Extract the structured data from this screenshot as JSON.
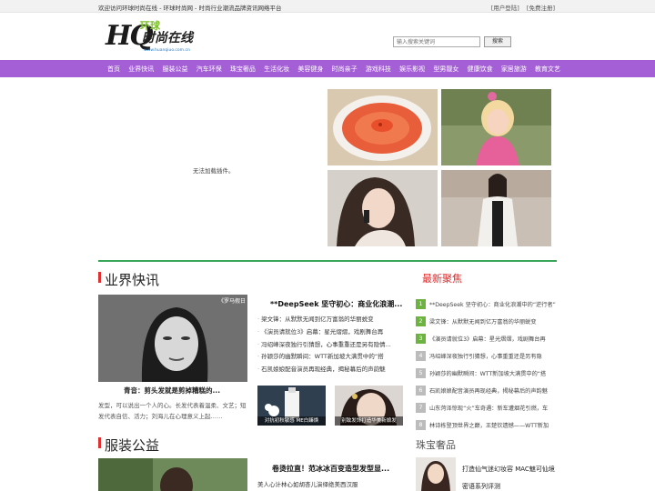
{
  "topbar": {
    "welcome": "欢迎访问环球时尚在线 - 环球时尚网 - 时尚行业潮流品牌资讯网络平台",
    "login": "[用户登陆]",
    "register": "[免费注册]"
  },
  "logo": {
    "hq": "HQ",
    "huanqiu": "环球",
    "fashion": "时尚在线",
    "url": "www.huanqiuo.com.cn"
  },
  "search": {
    "placeholder": "输入搜索关键词",
    "button": "搜索"
  },
  "nav": [
    "首页",
    "业界快讯",
    "服装公益",
    "汽车环保",
    "珠宝奢品",
    "生活化妆",
    "美容健身",
    "时尚亲子",
    "游戏科技",
    "娱乐影视",
    "型男靓女",
    "健康饮食",
    "家居旅游",
    "教育文艺"
  ],
  "plugin_message": "无法加载插件。",
  "section1": {
    "title": "业界快讯",
    "photo_caption": "青音：剪头发就是剪掉糟糕的...",
    "photo_overlay": "《罗马假日",
    "desc": "发型，可以说出一个人的心。长发代表着温柔、文艺；短发代表自信、活力；刘海儿在心理意义上起……",
    "headline": "**DeepSeek 坚守初心：商业化浪潮...",
    "news": [
      "梁文锋：从默默无闻到亿万富翁的华丽蜕变",
      "《演员请就位3》启幕：星光熠熠，戏剧舞台再",
      "冯绍峰深夜独行引猜想，心事重重还是另有隐情...",
      "孙颖莎的幽默瞬间：WTT新加坡大满贯中的“搭",
      "石凯娘娘配音演员再现经典，揭秘幕后的声韵魅"
    ],
    "small_pics": [
      "对抗初秋敏感 ME白臻焕",
      "别致发饰打造华美新娘发"
    ]
  },
  "hot": {
    "title": "最新聚焦",
    "items": [
      "**DeepSeek 坚守初心：商业化浪潮中的“逆行者”",
      "梁文锋：从默默无闻到亿万富翁的华丽蜕变",
      "《演员请就位3》启幕：星光熠熠，戏剧舞台再",
      "冯绍峰深夜独行引猜想，心事重重还是另有隐",
      "孙颖莎的幽默瞬间：WTT新加坡大满贯中的“搭",
      "石凯娘娘配音演员再现经典，揭秘幕后的声韵魅",
      "山东菏泽惊现“火”车奇遇：新车遭烟花引燃，车",
      "林诗栋登顶世界之巅，王楚钦遗憾——WTT新加"
    ],
    "num_colors": [
      "#6cb33f",
      "#6cb33f",
      "#6cb33f",
      "#bcbcbc",
      "#bcbcbc",
      "#bcbcbc",
      "#bcbcbc",
      "#bcbcbc"
    ]
  },
  "section2": {
    "title": "服装公益",
    "headline": "卷烫拉直！范冰冰百变造型发型显...",
    "item": "美人心计林心如胡杏儿演绎绝美西汉服"
  },
  "jewelry": {
    "title": "珠宝奢品",
    "line1": "打造仙气迷幻妆容 MAC魅可仙境",
    "line2": "密语系列评测"
  }
}
